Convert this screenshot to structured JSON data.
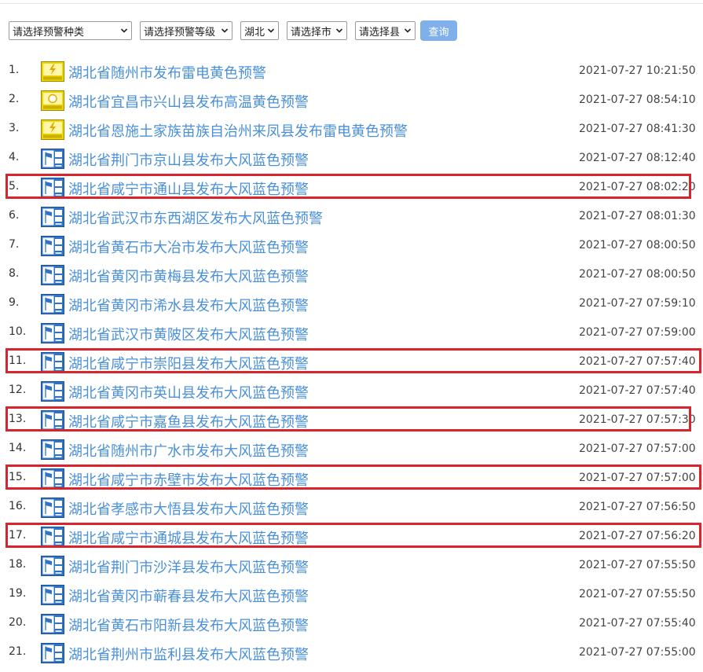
{
  "filters": {
    "type_select": "请选择预警种类",
    "level_select": "请选择预警等级",
    "province_select": "湖北",
    "city_select": "请选择市",
    "county_select": "请选择县",
    "query_button": "查询"
  },
  "colors": {
    "link": "#4a90d9",
    "highlight": "#d9232d",
    "yellow_icon": "#f2d400",
    "blue_icon": "#2f73c9",
    "button": "#7fb0ea"
  },
  "warnings": [
    {
      "num": "1.",
      "icon": "thunder-yellow-icon",
      "title": "湖北省随州市发布雷电黄色预警",
      "time": "2021-07-27 10:21:50",
      "highlighted": false
    },
    {
      "num": "2.",
      "icon": "heat-yellow-icon",
      "title": "湖北省宜昌市兴山县发布高温黄色预警",
      "time": "2021-07-27 08:54:10",
      "highlighted": false
    },
    {
      "num": "3.",
      "icon": "thunder-yellow-icon",
      "title": "湖北省恩施土家族苗族自治州来凤县发布雷电黄色预警",
      "time": "2021-07-27 08:41:30",
      "highlighted": false
    },
    {
      "num": "4.",
      "icon": "wind-blue-icon",
      "title": "湖北省荆门市京山县发布大风蓝色预警",
      "time": "2021-07-27 08:12:40",
      "highlighted": false
    },
    {
      "num": "5.",
      "icon": "wind-blue-icon",
      "title": "湖北省咸宁市通山县发布大风蓝色预警",
      "time": "2021-07-27 08:02:20",
      "highlighted": true
    },
    {
      "num": "6.",
      "icon": "wind-blue-icon",
      "title": "湖北省武汉市东西湖区发布大风蓝色预警",
      "time": "2021-07-27 08:01:30",
      "highlighted": false
    },
    {
      "num": "7.",
      "icon": "wind-blue-icon",
      "title": "湖北省黄石市大冶市发布大风蓝色预警",
      "time": "2021-07-27 08:00:50",
      "highlighted": false
    },
    {
      "num": "8.",
      "icon": "wind-blue-icon",
      "title": "湖北省黄冈市黄梅县发布大风蓝色预警",
      "time": "2021-07-27 08:00:50",
      "highlighted": false
    },
    {
      "num": "9.",
      "icon": "wind-blue-icon",
      "title": "湖北省黄冈市浠水县发布大风蓝色预警",
      "time": "2021-07-27 07:59:10",
      "highlighted": false
    },
    {
      "num": "10.",
      "icon": "wind-blue-icon",
      "title": "湖北省武汉市黄陂区发布大风蓝色预警",
      "time": "2021-07-27 07:59:00",
      "highlighted": false
    },
    {
      "num": "11.",
      "icon": "wind-blue-icon",
      "title": "湖北省咸宁市崇阳县发布大风蓝色预警",
      "time": "2021-07-27 07:57:40",
      "highlighted": true
    },
    {
      "num": "12.",
      "icon": "wind-blue-icon",
      "title": "湖北省黄冈市英山县发布大风蓝色预警",
      "time": "2021-07-27 07:57:40",
      "highlighted": false
    },
    {
      "num": "13.",
      "icon": "wind-blue-icon",
      "title": "湖北省咸宁市嘉鱼县发布大风蓝色预警",
      "time": "2021-07-27 07:57:30",
      "highlighted": true
    },
    {
      "num": "14.",
      "icon": "wind-blue-icon",
      "title": "湖北省随州市广水市发布大风蓝色预警",
      "time": "2021-07-27 07:57:00",
      "highlighted": false
    },
    {
      "num": "15.",
      "icon": "wind-blue-icon",
      "title": "湖北省咸宁市赤壁市发布大风蓝色预警",
      "time": "2021-07-27 07:57:00",
      "highlighted": true
    },
    {
      "num": "16.",
      "icon": "wind-blue-icon",
      "title": "湖北省孝感市大悟县发布大风蓝色预警",
      "time": "2021-07-27 07:56:50",
      "highlighted": false
    },
    {
      "num": "17.",
      "icon": "wind-blue-icon",
      "title": "湖北省咸宁市通城县发布大风蓝色预警",
      "time": "2021-07-27 07:56:20",
      "highlighted": true
    },
    {
      "num": "18.",
      "icon": "wind-blue-icon",
      "title": "湖北省荆门市沙洋县发布大风蓝色预警",
      "time": "2021-07-27 07:55:50",
      "highlighted": false
    },
    {
      "num": "19.",
      "icon": "wind-blue-icon",
      "title": "湖北省黄冈市蕲春县发布大风蓝色预警",
      "time": "2021-07-27 07:55:50",
      "highlighted": false
    },
    {
      "num": "20.",
      "icon": "wind-blue-icon",
      "title": "湖北省黄石市阳新县发布大风蓝色预警",
      "time": "2021-07-27 07:55:40",
      "highlighted": false
    },
    {
      "num": "21.",
      "icon": "wind-blue-icon",
      "title": "湖北省荆州市监利县发布大风蓝色预警",
      "time": "2021-07-27 07:55:00",
      "highlighted": false
    }
  ]
}
